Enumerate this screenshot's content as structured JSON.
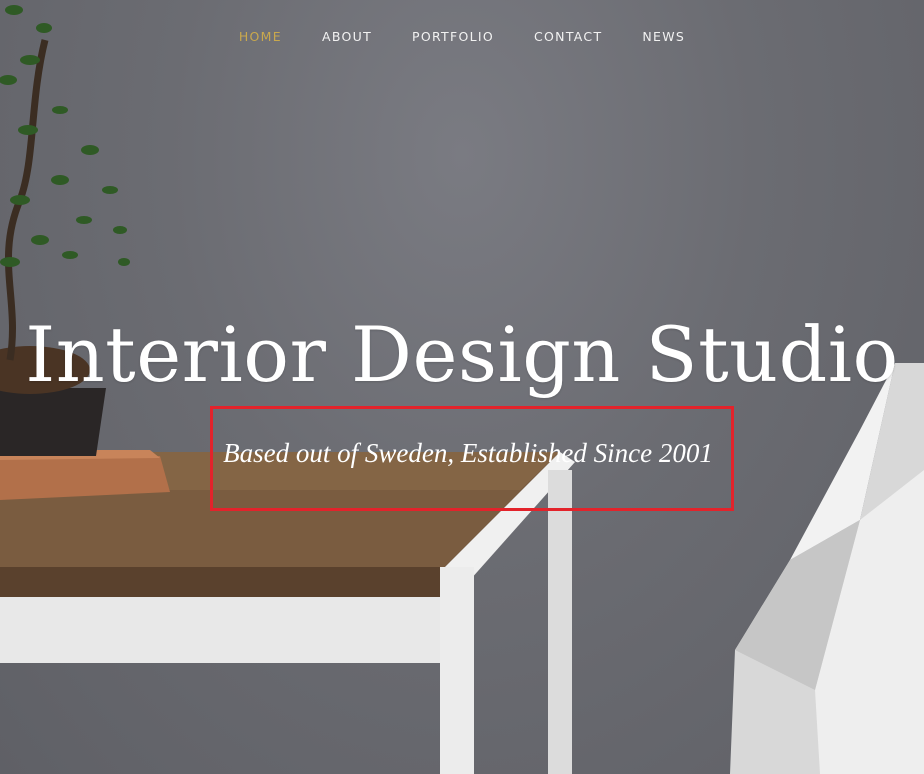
{
  "nav": {
    "items": [
      {
        "label": "HOME"
      },
      {
        "label": "ABOUT"
      },
      {
        "label": "PORTFOLIO"
      },
      {
        "label": "CONTACT"
      },
      {
        "label": "NEWS"
      }
    ]
  },
  "hero": {
    "title": "Interior Design Studio",
    "subtitle": "Based out of Sweden, Established Since 2001"
  },
  "colors": {
    "accent": "#c9a84d",
    "highlight": "#e3232b",
    "text": "#ffffff"
  }
}
